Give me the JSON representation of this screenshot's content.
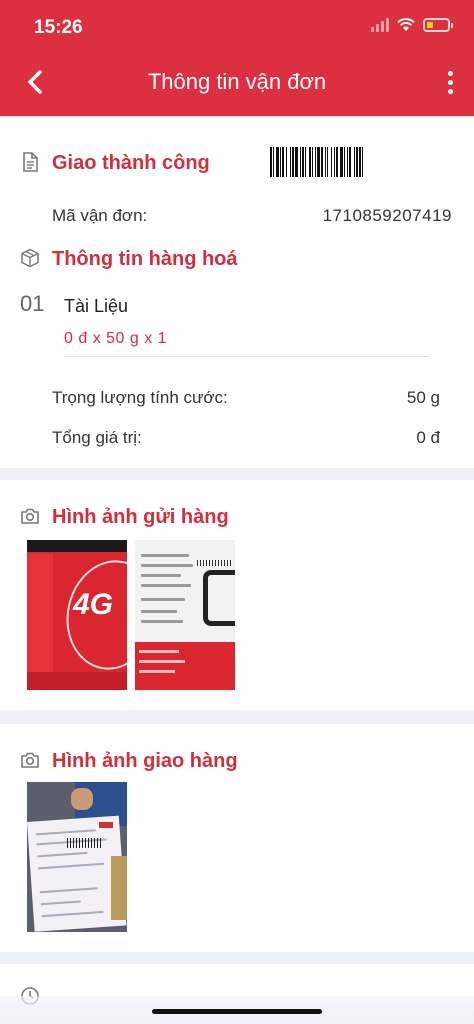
{
  "status_bar": {
    "time": "15:26"
  },
  "header": {
    "title": "Thông tin vận đơn"
  },
  "delivery": {
    "status": "Giao thành công",
    "waybill_label": "Mã vận đơn:",
    "waybill_value": "1710859207419"
  },
  "goods": {
    "title": "Thông tin hàng hoá",
    "items": [
      {
        "index": "01",
        "name": "Tài Liệu",
        "detail": "0 đ x 50 g x 1"
      }
    ],
    "charge_weight_label": "Trọng lượng tính cước:",
    "charge_weight_value": "50 g",
    "total_value_label": "Tổng giá trị:",
    "total_value_value": "0 đ"
  },
  "send_photos": {
    "title": "Hình ảnh gửi hàng"
  },
  "delivery_photos": {
    "title": "Hình ảnh giao hàng"
  },
  "colors": {
    "brand": "#dc2f3f",
    "accent_text": "#d12e3e",
    "background": "#eef1f7"
  },
  "icons": [
    "back-icon",
    "more-icon",
    "document-icon",
    "box-icon",
    "camera-icon",
    "clock-icon"
  ]
}
